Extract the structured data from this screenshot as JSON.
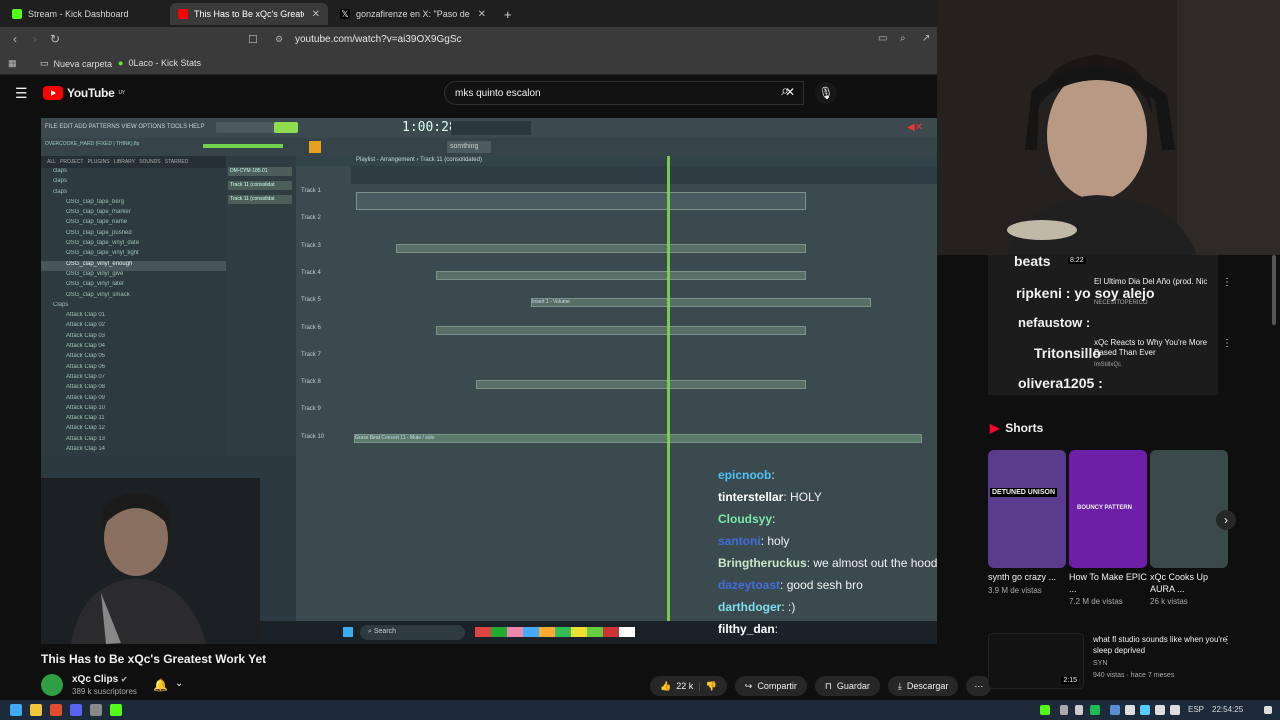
{
  "tabs": [
    {
      "title": "Stream - Kick Dashboard",
      "favicon_color": "#53fc18"
    },
    {
      "title": "This Has to Be xQc's Greatest",
      "favicon_color": "#ff0000"
    },
    {
      "title": "gonzafirenze en X: \"Paso de Coscu d",
      "favicon_color": "#ffffff"
    }
  ],
  "address": {
    "url": "youtube.com/watch?v=ai39OX9GgSc"
  },
  "bookmarks": [
    {
      "label": "Nueva carpeta"
    },
    {
      "label": "0Laco - Kick Stats"
    }
  ],
  "youtube": {
    "logo_text": "YouTube",
    "region": "UY",
    "search_value": "mks quinto escalon"
  },
  "daw": {
    "menu": "FILE  EDIT  ADD  PATTERNS  VIEW  OPTIONS  TOOLS  HELP",
    "time": "1:00:28",
    "playlist_title": "Playlist - Arrangement",
    "playlist_crumb": "Track 11 (consolidated)",
    "pattern_field": "somthing",
    "project_name": "OVERCOOKE_HARD (FIXED | THINK).flp",
    "browser_tabs": [
      "ALL",
      "PROJECT",
      "PLUGINS",
      "LIBRARY",
      "SOUNDS",
      "STARRED"
    ],
    "browser_items": [
      "claps",
      "claps",
      "claps",
      "OSG_clap_tape_berg",
      "OSG_clap_tape_marker",
      "OSG_clap_tape_name",
      "OSG_clap_tape_pushed",
      "OSG_clap_tape_vinyl_date",
      "OSG_clap_tape_vinyl_tight",
      "OSG_clap_vinyl_enough",
      "OSG_clap_vinyl_give",
      "OSG_clap_vinyl_later",
      "OSG_clap_vinyl_smack",
      "Claps",
      "Attack Clap 01",
      "Attack Clap 02",
      "Attack Clap 03",
      "Attack Clap 04",
      "Attack Clap 05",
      "Attack Clap 06",
      "Attack Clap 07",
      "Attack Clap 08",
      "Attack Clap 09",
      "Attack Clap 10",
      "Attack Clap 11",
      "Attack Clap 12",
      "Attack Clap 13",
      "Attack Clap 14"
    ],
    "patterns": [
      "DM-CYM-185.01",
      "Track 11 (consolidat",
      "Track 11 (consolidat"
    ],
    "tracks": [
      "Track 1",
      "Track 2",
      "Track 3",
      "Track 4",
      "Track 5",
      "Track 6",
      "Track 7",
      "Track 8",
      "Track 9",
      "Track 10"
    ],
    "clip_labels": {
      "track5": "Insert 1 - Volume",
      "track10": "Grass Beat Concert 11 - Mute / solo"
    },
    "taskbar_search": "Search"
  },
  "chat": [
    {
      "user": "epicnoob",
      "message": "",
      "color": "#4fc3f7"
    },
    {
      "user": "tinterstellar",
      "message": "HOLY",
      "color": "#ffffff"
    },
    {
      "user": "Cloudsyy",
      "message": "",
      "color": "#7ee8a8"
    },
    {
      "user": "santoni",
      "message": "holy",
      "color": "#3f6fd8"
    },
    {
      "user": "Bringtheruckus",
      "message": "we almost out the hood",
      "color": "#c8e6c9"
    },
    {
      "user": "dazeytoast",
      "message": "good sesh bro",
      "color": "#3f6fd8"
    },
    {
      "user": "darthdoger",
      "message": ":)",
      "color": "#80deea"
    },
    {
      "user": "filthy_dan",
      "message": "",
      "color": "#ffffff"
    }
  ],
  "video": {
    "title": "This Has to Be xQc's Greatest Work Yet",
    "channel": "xQc Clips",
    "subscribers": "389 k suscriptores",
    "likes": "22 k",
    "share_label": "Compartir",
    "save_label": "Guardar",
    "download_label": "Descargar"
  },
  "sidebar": {
    "top_items": [
      {
        "title": "El Ultimo Dia Del Año (prod. Nic",
        "meta": "NECESITOPERICO"
      },
      {
        "title": "xQc Reacts to Why You're More Based Than Ever",
        "meta": "ImStillxQc"
      }
    ],
    "overlay_names": [
      "beats",
      "ripkeni : yo soy alejo",
      "nefaustow :",
      "Tritonsillo",
      "olivera1205 :"
    ],
    "duration_top": "8:22",
    "shorts_heading": "Shorts",
    "shorts": [
      {
        "title": "synth go crazy ...",
        "views": "3.9 M de vistas",
        "overlay": "DETUNED UNISON",
        "color": "#5a3b8c"
      },
      {
        "title": "How To Make EPIC ...",
        "views": "7.2 M de vistas",
        "overlay": "BOUNCY PATTERN",
        "color": "#6d1fa8"
      },
      {
        "title": "xQc Cooks Up AURA ...",
        "views": "26 k vistas",
        "overlay": "",
        "color": "#3a4a4a"
      }
    ],
    "next_video": {
      "title": "what fl studio sounds like when you're sleep deprived",
      "channel": "SYN",
      "meta": "940 vistas · hace 7 meses",
      "duration": "2:15"
    }
  },
  "system_tray": {
    "lang": "ESP",
    "time": "22:54:25"
  }
}
